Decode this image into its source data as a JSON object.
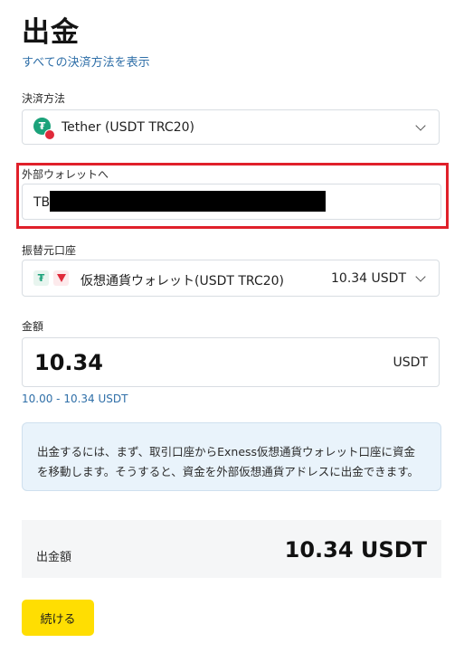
{
  "page": {
    "title": "出金",
    "show_all_link": "すべての決済方法を表示"
  },
  "payment_method": {
    "label": "決済方法",
    "value": "Tether (USDT TRC20)"
  },
  "external_wallet": {
    "label": "外部ウォレットへ",
    "value": "TB"
  },
  "source_account": {
    "label": "振替元口座",
    "name": "仮想通貨ウォレット(USDT TRC20)",
    "balance": "10.34 USDT"
  },
  "amount": {
    "label": "金額",
    "value": "10.34",
    "currency": "USDT",
    "range": "10.00 - 10.34 USDT"
  },
  "info": {
    "line1": "出金するには、まず、取引口座からExness仮想通貨ウォレット口座に資金",
    "line2": "を移動します。そうすると、資金を外部仮想通貨アドレスに出金できます。"
  },
  "summary": {
    "label": "出金額",
    "value": "10.34 USDT"
  },
  "actions": {
    "continue_label": "続ける"
  },
  "colors": {
    "accent_button": "#ffde02",
    "link": "#2f6fa8",
    "highlight": "#e0202a",
    "tether": "#1ba27a",
    "tron": "#e02a3a"
  },
  "icons": {
    "payment_method": "tether-icon",
    "source_account": [
      "tether-icon",
      "tron-icon"
    ],
    "dropdown": "chevron-down-icon"
  }
}
